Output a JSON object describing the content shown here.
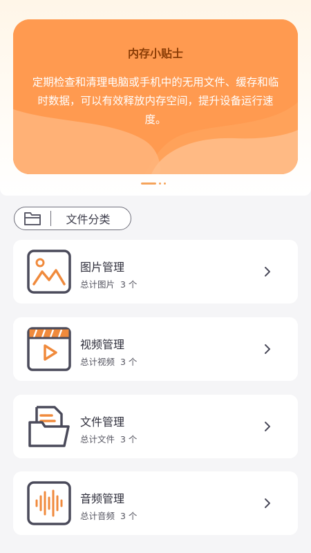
{
  "tips": {
    "title": "内存小贴士",
    "body": "定期检查和清理电脑或手机中的无用文件、缓存和临时数据，可以有效释放内存空间，提升设备运行速度。",
    "pager": {
      "count": 3,
      "active": 0
    }
  },
  "category": {
    "label": "文件分类",
    "icon": "folder-icon"
  },
  "managers": [
    {
      "title": "图片管理",
      "subtitle": "总计图片  3 个",
      "icon": "image-icon"
    },
    {
      "title": "视频管理",
      "subtitle": "总计视频  3 个",
      "icon": "video-icon"
    },
    {
      "title": "文件管理",
      "subtitle": "总计文件  3 个",
      "icon": "document-icon"
    },
    {
      "title": "音频管理",
      "subtitle": "总计音频  3 个",
      "icon": "audio-icon"
    }
  ],
  "colors": {
    "accent": "#f08a3c",
    "card_bg": "#ffae6a",
    "icon_stroke": "#4a4a5a"
  }
}
